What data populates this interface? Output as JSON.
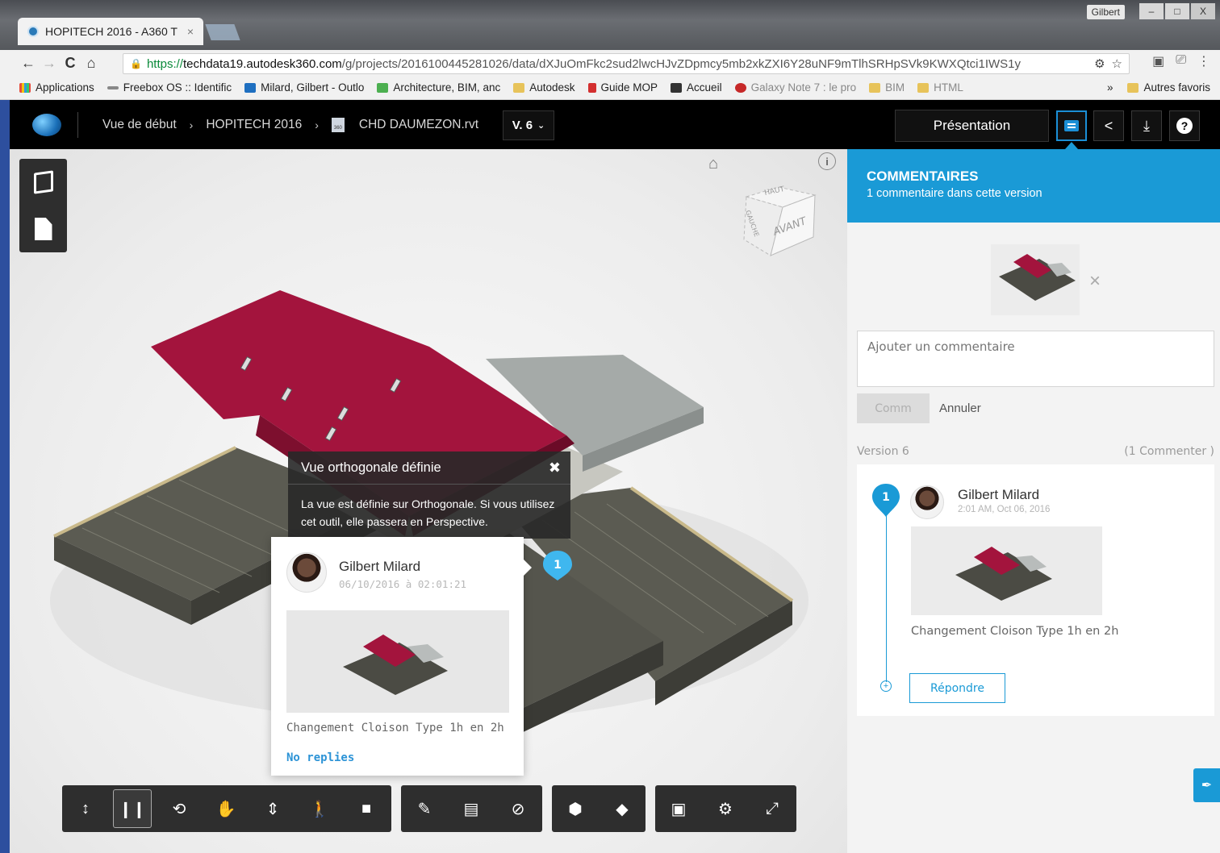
{
  "browser": {
    "tab_title": "HOPITECH 2016 - A360 T",
    "tab_close": "×",
    "window_user": "Gilbert",
    "win_min": "–",
    "win_max": "□",
    "win_close": "X",
    "nav": {
      "back": "←",
      "forward": "→",
      "reload": "C",
      "home": "⌂"
    },
    "url": {
      "protocol": "https://",
      "host": "techdata19.autodesk360.com",
      "path": "/g/projects/20161004452810​26/data/dXJuOmFkc2sud2lwcHJvZDpmcy5mb2xkZXI6Y28uNF9mTlhSRHpSVk9KWXQtci1IWS1y"
    },
    "bookmarks": [
      {
        "label": "Applications",
        "icon": "apps-grid-icon",
        "faded": false
      },
      {
        "label": "Freebox OS :: Identific",
        "icon": "freebox-icon",
        "faded": false
      },
      {
        "label": "Milard, Gilbert - Outlo",
        "icon": "outlook-icon",
        "faded": false
      },
      {
        "label": "Architecture, BIM, anc",
        "icon": "site-icon",
        "faded": false
      },
      {
        "label": "Autodesk",
        "icon": "folder-icon",
        "faded": false
      },
      {
        "label": "Guide MOP",
        "icon": "t-logo-icon",
        "faded": false
      },
      {
        "label": "Accueil",
        "icon": "accueil-icon",
        "faded": false
      },
      {
        "label": "Galaxy Note 7 : le pro",
        "icon": "zd-icon",
        "faded": true
      },
      {
        "label": "BIM",
        "icon": "folder-icon",
        "faded": true
      },
      {
        "label": "HTML",
        "icon": "folder-icon",
        "faded": true
      }
    ],
    "bookmarks_more": "»",
    "other_bookmarks": "Autres favoris"
  },
  "app": {
    "breadcrumb": [
      "Vue de début",
      "HOPITECH 2016",
      "CHD DAUMEZON.rvt"
    ],
    "file_badge": "360",
    "version": "V. 6",
    "presentation_label": "Présentation",
    "accent": "#1a9ad6"
  },
  "viewer": {
    "viewcube": {
      "top": "HAUT",
      "front": "AVANT",
      "left": "GAUCHE"
    },
    "toast": {
      "title": "Vue orthogonale définie",
      "close": "✖",
      "body": "La vue est définie sur Orthogonale. Si vous utilisez cet outil, elle passera en Perspective."
    },
    "popup": {
      "author": "Gilbert Milard",
      "date": "06/10/2016 à 02:01:21",
      "text": "Changement Cloison Type 1h en 2h",
      "replies": "No replies"
    },
    "pin_number": "1",
    "toolbar_groups": [
      [
        "camera-orbit-icon",
        "first-person-icon",
        "orbit-icon",
        "pan-icon",
        "zoom-icon",
        "walk-icon",
        "camera-icon"
      ],
      [
        "markup-icon",
        "comment-icon",
        "hide-icon"
      ],
      [
        "explode-icon",
        "section-icon"
      ],
      [
        "model-browser-icon",
        "settings-icon",
        "fullscreen-icon"
      ]
    ]
  },
  "comments": {
    "title": "COMMENTAIRES",
    "subtitle": "1 commentaire dans cette version",
    "input_placeholder": "Ajouter un commentaire",
    "submit_label": "Comm",
    "cancel_label": "Annuler",
    "version_label": "Version 6",
    "count_label": "(1 Commenter )",
    "item": {
      "number": "1",
      "author": "Gilbert Milard",
      "date": "2:01 AM, Oct 06, 2016",
      "text": "Changement Cloison Type 1h en 2h",
      "reply_label": "Répondre"
    }
  }
}
